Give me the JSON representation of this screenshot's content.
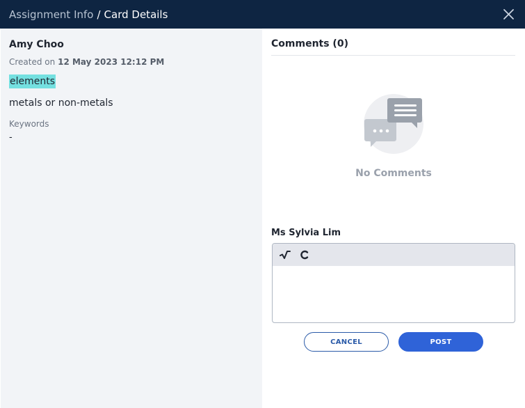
{
  "header": {
    "breadcrumb_parent": "Assignment Info",
    "breadcrumb_separator": "/",
    "breadcrumb_current": "Card Details",
    "close_icon": "close-icon"
  },
  "card": {
    "author": "Amy Choo",
    "created_prefix": "Created on",
    "created_date": "12 May 2023 12:12 PM",
    "title": "elements",
    "description": "metals or non-metals",
    "keywords_label": "Keywords",
    "keywords_value": "-"
  },
  "comments": {
    "header": "Comments (0)",
    "empty_icon": "chat-bubbles-icon",
    "empty_text": "No Comments",
    "commenter_name": "Ms Sylvia Lim",
    "toolbar": {
      "math_icon": "square-root-icon",
      "chemistry_icon": "chemistry-c-icon"
    },
    "cancel_label": "CANCEL",
    "post_label": "POST"
  },
  "colors": {
    "header_bg": "#0e2542",
    "left_bg": "#f2f4f7",
    "highlight": "#74e0e0",
    "primary": "#2f63d8"
  }
}
